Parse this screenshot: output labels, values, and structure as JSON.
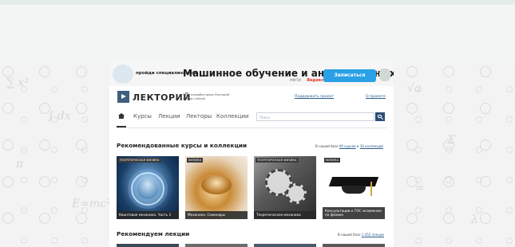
{
  "banner": {
    "pre_text": "пройди специализацию",
    "title": "Машинное обучение и анализ данных",
    "partner_text": "МФТИ",
    "yandex_text": "Яндекс",
    "cta_label": "Записаться",
    "cta_color": "#2aa0e6"
  },
  "header": {
    "logo_text": "ЛЕКТОРИЙ",
    "tagline_line1": "Сайт разработчиков Лекторий",
    "tagline_line2": "Создан Lektorij",
    "support_link": "Поддержать проект",
    "about_link": "О проекте",
    "brand_color": "#3f5f7e"
  },
  "nav": {
    "home_icon": "home-icon",
    "items": [
      "Курсы",
      "Лекции",
      "Лекторы",
      "Коллекции"
    ],
    "search_placeholder": "Поиск",
    "search_icon": "search-icon"
  },
  "recommended_courses": {
    "title": "Рекомендованные курсы и коллекции",
    "meta_prefix": "В нашей базе",
    "meta_courses_link": "90 курсов",
    "meta_and": "и",
    "meta_collections_link": "18 коллекций",
    "cards": [
      {
        "tag": "ТЕОРЕТИЧЕСКАЯ ФИЗИКА",
        "caption": "Квантовая механика. Часть 1"
      },
      {
        "tag": "ФИЗИКА",
        "caption": "Механика. Семинары"
      },
      {
        "tag": "ТЕОРЕТИЧЕСКАЯ ФИЗИКА",
        "caption": "Теоретическая механика"
      },
      {
        "tag": "ФИЗИКА",
        "caption": "Консультации к ГОС экзаменам по физике"
      }
    ]
  },
  "recommended_lectures": {
    "title": "Рекомендуем лекции",
    "meta_prefix": "В нашей базе",
    "meta_lectures_link": "1 452 лекции"
  }
}
